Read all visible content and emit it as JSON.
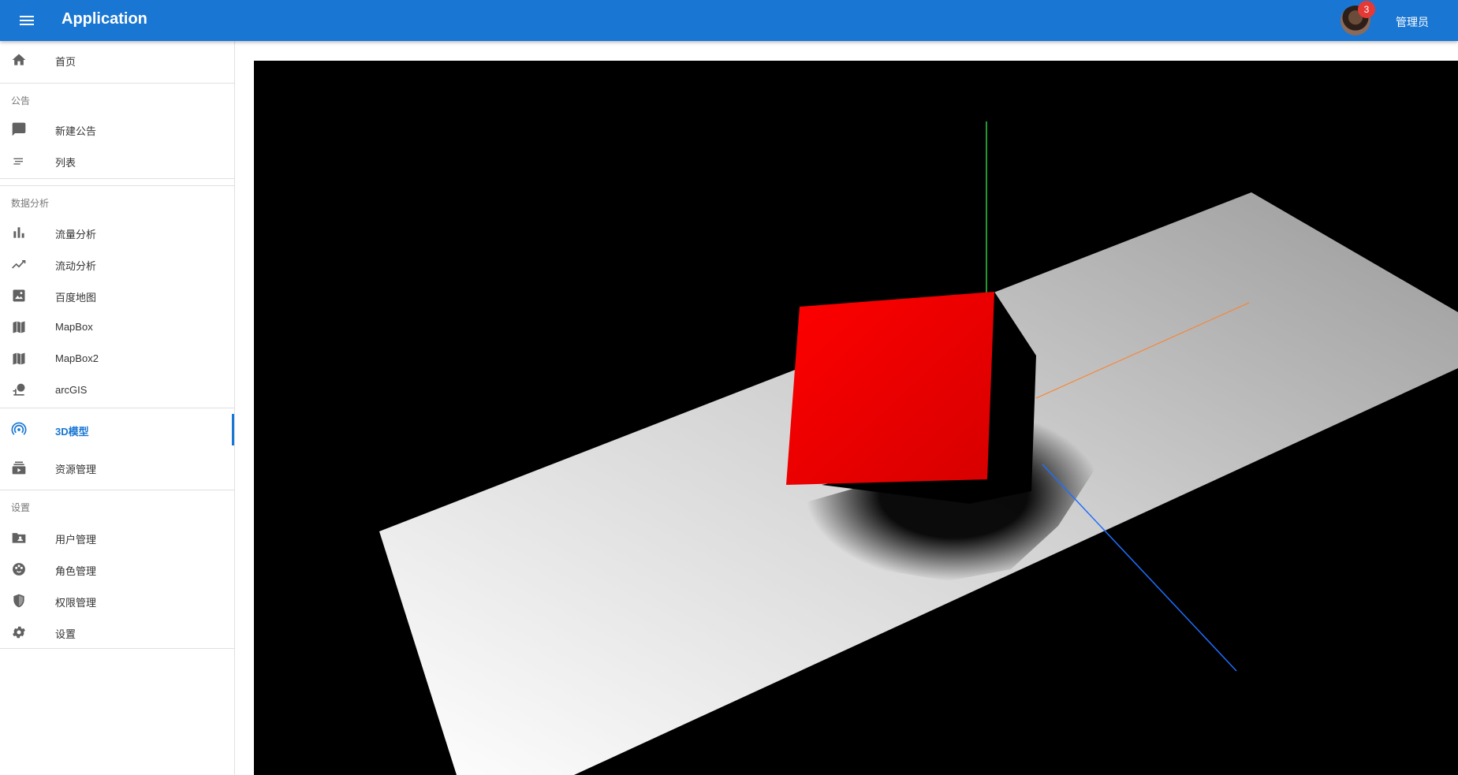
{
  "appbar": {
    "title": "Application",
    "notification_count": "3",
    "user_name": "管理员",
    "accent_color": "#1976d2"
  },
  "sidebar": {
    "home": {
      "label": "首页",
      "icon": "home-icon"
    },
    "sections": [
      {
        "header": "公告",
        "items": [
          {
            "label": "新建公告",
            "icon": "message-icon"
          },
          {
            "label": "列表",
            "icon": "notes-list-icon"
          }
        ]
      },
      {
        "header": "数据分析",
        "items": [
          {
            "label": "流量分析",
            "icon": "bar-chart-icon"
          },
          {
            "label": "流动分析",
            "icon": "trending-line-icon"
          },
          {
            "label": "百度地图",
            "icon": "image-icon"
          },
          {
            "label": "MapBox",
            "icon": "map-icon"
          },
          {
            "label": "MapBox2",
            "icon": "map-icon"
          },
          {
            "label": "arcGIS",
            "icon": "pin-globe-icon"
          }
        ]
      },
      {
        "header": "",
        "items": [
          {
            "label": "3D模型",
            "icon": "radar-icon",
            "active": true
          },
          {
            "label": "资源管理",
            "icon": "resource-stack-icon"
          }
        ]
      },
      {
        "header": "设置",
        "items": [
          {
            "label": "用户管理",
            "icon": "user-folder-icon"
          },
          {
            "label": "角色管理",
            "icon": "role-palette-icon"
          },
          {
            "label": "权限管理",
            "icon": "shield-icon"
          },
          {
            "label": "设置",
            "icon": "gear-icon"
          }
        ]
      }
    ]
  },
  "scene": {
    "background": "#000000",
    "cube_color": "#e00000",
    "plane_color": "#d8d8d8",
    "axis_colors": {
      "x": "#ff7f27",
      "y": "#2ecc40",
      "z": "#1e6fff"
    }
  }
}
